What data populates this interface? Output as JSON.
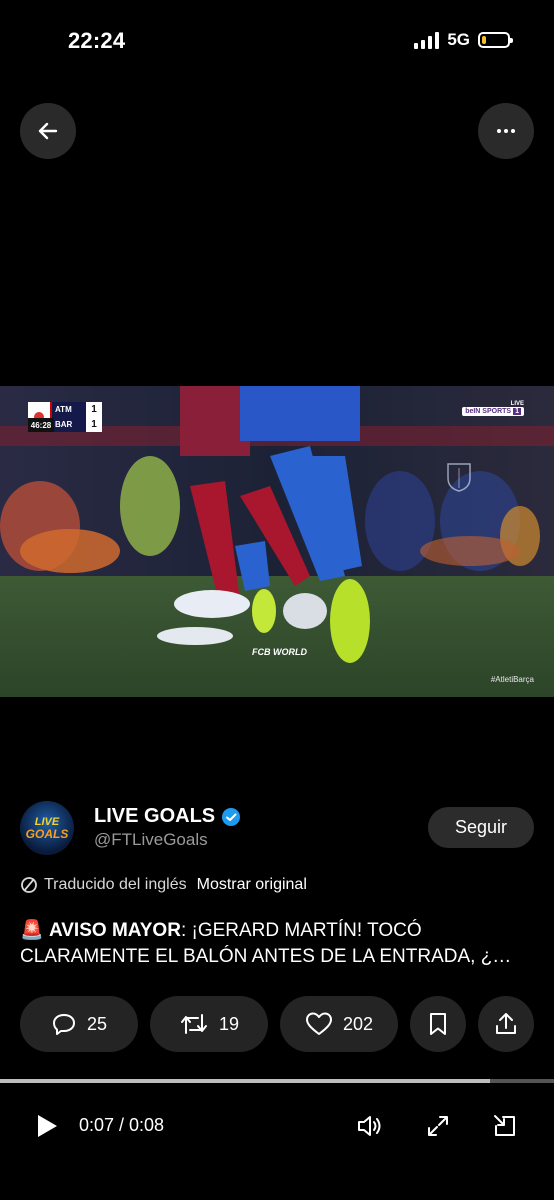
{
  "status_bar": {
    "time": "22:24",
    "network": "5G"
  },
  "video": {
    "scoreboard": {
      "clock": "46:28",
      "team1": "ATM",
      "score1": "1",
      "team2": "BAR",
      "score2": "1"
    },
    "broadcaster": {
      "live": "LIVE",
      "brand": "beIN SPORTS",
      "channel": "1"
    },
    "watermark": "FCB WORLD",
    "hashtag": "#AtletiBarça"
  },
  "tweet": {
    "display_name": "LIVE GOALS",
    "handle": "@FTLiveGoals",
    "avatar_line1": "LIVE",
    "avatar_line2": "GOALS",
    "follow_label": "Seguir",
    "translated_label": "Traducido del inglés",
    "show_original_label": "Mostrar original",
    "emoji": "🚨",
    "text_bold": "AVISO MAYOR",
    "text_line1": ": ¡GERARD MARTÍN! TOCÓ",
    "text_line2": "CLARAMENTE EL BALÓN ANTES DE LA ENTRADA, ¿…"
  },
  "actions": {
    "replies": "25",
    "retweets": "19",
    "likes": "202"
  },
  "player": {
    "time": "0:07 / 0:08",
    "progress": 0.885
  },
  "colors": {
    "verified": "#1d9bf0",
    "battery_low": "#f5c020"
  },
  "icons": [
    "back-arrow-icon",
    "more-icon",
    "verified-badge-icon",
    "translate-icon",
    "reply-icon",
    "retweet-icon",
    "like-icon",
    "bookmark-icon",
    "share-icon",
    "play-icon",
    "volume-icon",
    "expand-icon",
    "minimize-icon"
  ]
}
